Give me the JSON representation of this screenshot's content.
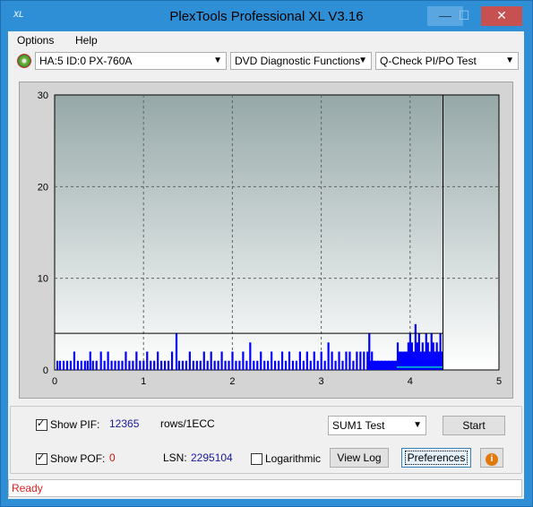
{
  "window": {
    "title": "PlexTools Professional XL V3.16",
    "app_icon": "XL"
  },
  "menu": {
    "options": "Options",
    "help": "Help"
  },
  "toolbar": {
    "drive": "HA:5 ID:0  PX-760A",
    "function": "DVD Diagnostic Functions",
    "test": "Q-Check PI/PO Test"
  },
  "chart_data": {
    "type": "bar",
    "x_ticks": [
      "0",
      "1",
      "2",
      "3",
      "4",
      "5"
    ],
    "y_ticks": [
      "0",
      "10",
      "20",
      "30"
    ],
    "xlim": [
      0,
      5
    ],
    "ylim": [
      0,
      30
    ],
    "threshold": 4,
    "end_marker_x": 4.37,
    "grid": true,
    "colors": {
      "bar": "#0000ff",
      "po": "#00c8c8",
      "bg_top": "#96a8a8",
      "bg_bottom": "#ffffff"
    },
    "bars": [
      [
        0.03,
        1
      ],
      [
        0.06,
        1
      ],
      [
        0.1,
        1
      ],
      [
        0.14,
        1
      ],
      [
        0.18,
        1
      ],
      [
        0.22,
        2
      ],
      [
        0.26,
        1
      ],
      [
        0.3,
        1
      ],
      [
        0.34,
        1
      ],
      [
        0.37,
        1
      ],
      [
        0.4,
        2
      ],
      [
        0.43,
        1
      ],
      [
        0.47,
        1
      ],
      [
        0.52,
        2
      ],
      [
        0.56,
        1
      ],
      [
        0.6,
        2
      ],
      [
        0.64,
        1
      ],
      [
        0.68,
        1
      ],
      [
        0.72,
        1
      ],
      [
        0.76,
        1
      ],
      [
        0.8,
        2
      ],
      [
        0.84,
        1
      ],
      [
        0.88,
        1
      ],
      [
        0.92,
        2
      ],
      [
        0.96,
        1
      ],
      [
        1.0,
        1
      ],
      [
        1.04,
        2
      ],
      [
        1.08,
        1
      ],
      [
        1.12,
        1
      ],
      [
        1.16,
        2
      ],
      [
        1.2,
        1
      ],
      [
        1.24,
        1
      ],
      [
        1.28,
        1
      ],
      [
        1.32,
        2
      ],
      [
        1.37,
        4
      ],
      [
        1.4,
        1
      ],
      [
        1.44,
        1
      ],
      [
        1.48,
        1
      ],
      [
        1.52,
        2
      ],
      [
        1.56,
        1
      ],
      [
        1.6,
        1
      ],
      [
        1.64,
        1
      ],
      [
        1.68,
        2
      ],
      [
        1.72,
        1
      ],
      [
        1.76,
        2
      ],
      [
        1.8,
        1
      ],
      [
        1.84,
        1
      ],
      [
        1.88,
        2
      ],
      [
        1.92,
        1
      ],
      [
        1.96,
        1
      ],
      [
        2.0,
        2
      ],
      [
        2.04,
        1
      ],
      [
        2.08,
        1
      ],
      [
        2.12,
        2
      ],
      [
        2.16,
        1
      ],
      [
        2.2,
        3
      ],
      [
        2.24,
        1
      ],
      [
        2.28,
        1
      ],
      [
        2.32,
        2
      ],
      [
        2.36,
        1
      ],
      [
        2.4,
        1
      ],
      [
        2.44,
        2
      ],
      [
        2.48,
        1
      ],
      [
        2.52,
        1
      ],
      [
        2.56,
        2
      ],
      [
        2.6,
        1
      ],
      [
        2.64,
        2
      ],
      [
        2.68,
        1
      ],
      [
        2.72,
        1
      ],
      [
        2.76,
        2
      ],
      [
        2.8,
        1
      ],
      [
        2.84,
        2
      ],
      [
        2.88,
        1
      ],
      [
        2.92,
        2
      ],
      [
        2.96,
        1
      ],
      [
        3.0,
        2
      ],
      [
        3.04,
        1
      ],
      [
        3.08,
        3
      ],
      [
        3.12,
        2
      ],
      [
        3.16,
        1
      ],
      [
        3.2,
        2
      ],
      [
        3.24,
        1
      ],
      [
        3.28,
        2
      ],
      [
        3.32,
        2
      ],
      [
        3.36,
        1
      ],
      [
        3.4,
        2
      ],
      [
        3.44,
        2
      ],
      [
        3.48,
        2
      ],
      [
        3.52,
        2
      ],
      [
        3.54,
        4
      ],
      [
        3.57,
        2
      ],
      [
        3.6,
        1
      ],
      [
        3.64,
        1
      ],
      [
        3.68,
        1
      ],
      [
        3.72,
        1
      ],
      [
        3.76,
        1
      ],
      [
        3.8,
        1
      ],
      [
        3.84,
        1
      ],
      [
        3.86,
        3
      ],
      [
        3.88,
        2
      ],
      [
        3.9,
        2
      ],
      [
        3.92,
        2
      ],
      [
        3.94,
        2
      ],
      [
        3.96,
        2
      ],
      [
        3.98,
        3
      ],
      [
        4.0,
        4
      ],
      [
        4.02,
        3
      ],
      [
        4.04,
        2
      ],
      [
        4.06,
        5
      ],
      [
        4.08,
        3
      ],
      [
        4.1,
        4
      ],
      [
        4.12,
        2
      ],
      [
        4.14,
        3
      ],
      [
        4.16,
        2
      ],
      [
        4.18,
        4
      ],
      [
        4.2,
        3
      ],
      [
        4.22,
        2
      ],
      [
        4.24,
        4
      ],
      [
        4.26,
        3
      ],
      [
        4.28,
        2
      ],
      [
        4.3,
        3
      ],
      [
        4.32,
        2
      ],
      [
        4.34,
        4
      ],
      [
        4.36,
        2
      ]
    ]
  },
  "panel": {
    "show_pif_label": "Show PIF:",
    "pif_value": "12365",
    "rows_label": "rows/1ECC",
    "show_pof_label": "Show POF:",
    "pof_value": "0",
    "lsn_label": "LSN:",
    "lsn_value": "2295104",
    "log_label": "Logarithmic",
    "sum_select": "SUM1 Test",
    "start_button": "Start",
    "view_log_button": "View Log",
    "preferences_button": "Preferences",
    "info_icon": "info-icon"
  },
  "status": {
    "text": "Ready"
  }
}
